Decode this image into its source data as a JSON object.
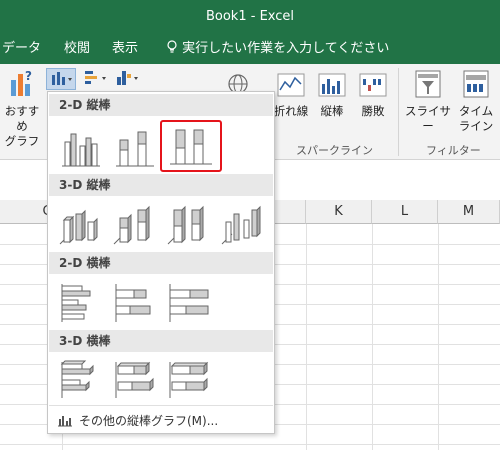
{
  "window": {
    "title": "Book1 - Excel"
  },
  "tabs": [
    {
      "label": "データ"
    },
    {
      "label": "校閲"
    },
    {
      "label": "表示"
    }
  ],
  "tellme": {
    "text": "実行したい作業を入力してください"
  },
  "ribbon": {
    "recommended": {
      "line1": "おすすめ",
      "line2": "グラフ"
    },
    "sparkline_line": "折れ線",
    "sparkline_column": "縦棒",
    "sparkline_winloss": "勝敗",
    "sparkline_group": "スパークライン",
    "slicer": "スライサー",
    "timeline": {
      "line1": "タイム",
      "line2": "ライン"
    },
    "filter_group": "フィルター"
  },
  "columns": [
    "G",
    "K",
    "L",
    "M"
  ],
  "dropdown": {
    "sections": [
      {
        "title": "2-D 縦棒"
      },
      {
        "title": "3-D 縦棒"
      },
      {
        "title": "2-D 横棒"
      },
      {
        "title": "3-D 横棒"
      }
    ],
    "more_charts": "その他の縦棒グラフ(M)..."
  },
  "colors": {
    "excel_green": "#217346",
    "highlight": "#e5141b"
  }
}
